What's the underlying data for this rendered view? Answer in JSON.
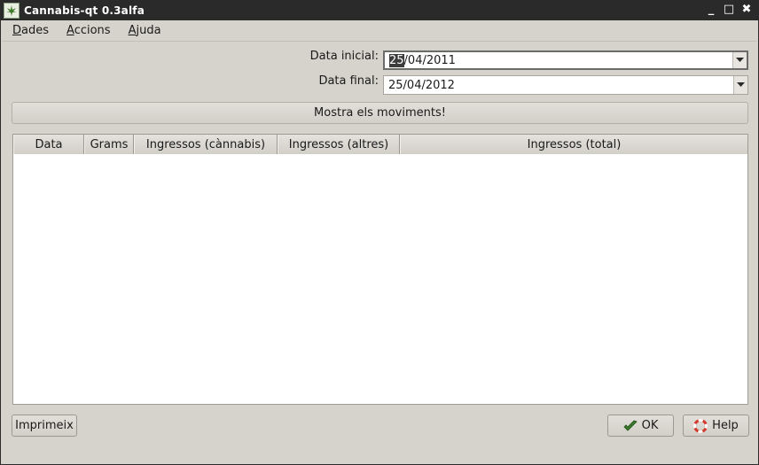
{
  "window": {
    "title": "Cannabis-qt 0.3alfa",
    "controls": {
      "minimize": "_",
      "maximize": "□",
      "close": "✖"
    }
  },
  "menu": [
    {
      "mnemonic": "D",
      "rest": "ades"
    },
    {
      "mnemonic": "A",
      "rest": "ccions"
    },
    {
      "mnemonic": "A",
      "rest": "juda"
    }
  ],
  "form": {
    "start_label": "Data inicial:",
    "start_value_selected": "25",
    "start_value_rest": "/04/2011",
    "end_label": "Data final:",
    "end_value": "25/04/2012"
  },
  "show_button": "Mostra els moviments!",
  "table": {
    "columns": [
      "Data",
      "Grams",
      "Ingressos (cànnabis)",
      "Ingressos (altres)",
      "Ingressos (total)"
    ],
    "rows": []
  },
  "buttons": {
    "print": "Imprimeix",
    "ok": "OK",
    "help": "Help"
  },
  "icons": {
    "app": "cannabis-leaf-icon",
    "dropdown": "chevron-down-icon",
    "ok": "checkmark-icon",
    "help": "lifebuoy-icon"
  }
}
